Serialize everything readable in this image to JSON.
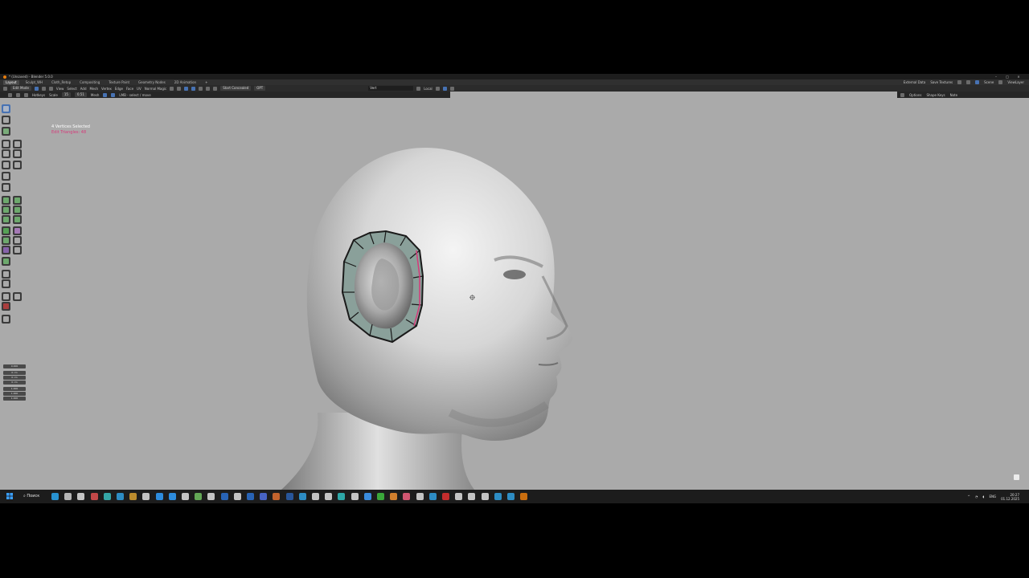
{
  "window": {
    "title": "* (Unsaved) - Blender 5.0.0"
  },
  "workspace_tabs": [
    {
      "label": "Layout",
      "active": true
    },
    {
      "label": "Sculpt_WH",
      "active": false
    },
    {
      "label": "Cloth_Retop",
      "active": false
    },
    {
      "label": "Compositing",
      "active": false
    },
    {
      "label": "Texture Paint",
      "active": false
    },
    {
      "label": "Geometry Nodes",
      "active": false
    },
    {
      "label": "2D Animation",
      "active": false
    }
  ],
  "topbar_right": {
    "external_data": "External Data",
    "save_textures": "Save Textures",
    "scene": "Scene",
    "view_layer": "ViewLayer"
  },
  "header": {
    "mode": "Edit Mode",
    "menus": [
      "View",
      "Select",
      "Add",
      "Mesh",
      "Vertex",
      "Edge",
      "Face",
      "UV",
      "Normal Magic"
    ],
    "start_concealed": "Start Concealed",
    "opt": "OPT",
    "search_value": "Vert",
    "local": "Local"
  },
  "tool_header": {
    "hotkeys": "Hotkeys",
    "scale": "Scale",
    "scale_value": "15",
    "value": "0.51",
    "mode_label": "Mesh",
    "lmb": "LMB - select / move"
  },
  "tool_header_right": {
    "options": "Options",
    "shape_keys": "Shape Keys",
    "n_tab": "Note"
  },
  "viewport_stats": {
    "vertices": "4 Vertices Selected",
    "triangles": "Edit Triangles: 48"
  },
  "props": {
    "fields": [
      "0.000",
      "0 cm",
      "0 cm",
      "0 cm",
      "1.000",
      "1.000",
      "1.000"
    ]
  },
  "taskbar": {
    "search": "Поиск",
    "lang": "ENG",
    "time": "20:27",
    "date": "01.12.2025"
  },
  "colors": {
    "selection_pink": "#d63a7a",
    "accent_blue": "#4772b3",
    "viewport_bg": "#aaaaaa",
    "blender_orange": "#e87d0d"
  },
  "icons": {
    "start": "windows-start-icon",
    "lock": "lock-icon",
    "cursor": "3d-cursor-icon"
  }
}
